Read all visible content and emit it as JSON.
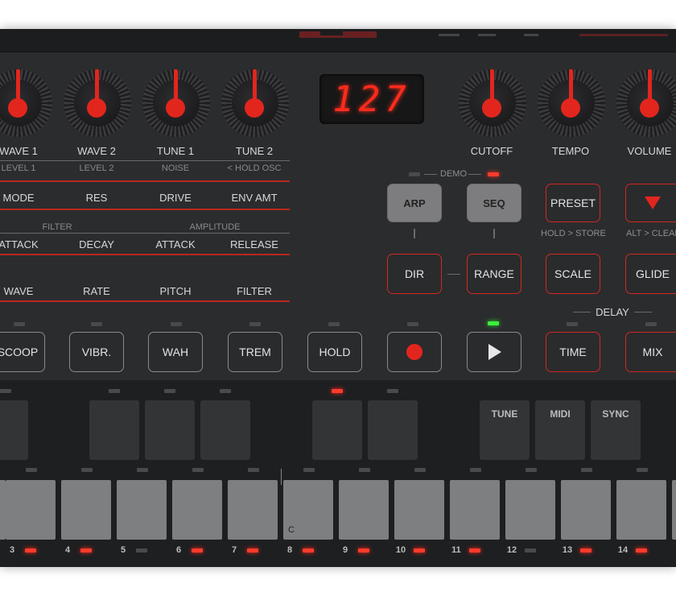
{
  "display_value": "127",
  "knobs_left": [
    {
      "label": "WAVE 1",
      "sub": "LEVEL 1"
    },
    {
      "label": "WAVE 2",
      "sub": "LEVEL 2"
    },
    {
      "label": "TUNE 1",
      "sub": "NOISE"
    },
    {
      "label": "TUNE 2",
      "sub": "< HOLD OSC"
    }
  ],
  "knobs_right": [
    {
      "label": "CUTOFF"
    },
    {
      "label": "TEMPO"
    },
    {
      "label": "VOLUME"
    }
  ],
  "param_rows": {
    "row1": [
      "MODE",
      "RES",
      "DRIVE",
      "ENV AMT"
    ],
    "section_filter": "FILTER",
    "section_amplitude": "AMPLITUDE",
    "row2": [
      "ATTACK",
      "DECAY",
      "ATTACK",
      "RELEASE"
    ],
    "row3": [
      "WAVE",
      "RATE",
      "PITCH",
      "FILTER"
    ]
  },
  "demo_label": "DEMO",
  "mode_buttons": {
    "arp": "ARP",
    "seq": "SEQ",
    "dir": "DIR",
    "range": "RANGE"
  },
  "preset_button": "PRESET",
  "hold_store": "HOLD > STORE",
  "alt_clear": "ALT > CLEAR",
  "scale_button": "SCALE",
  "glide_button": "GLIDE",
  "delay_label": "DELAY",
  "time_button": "TIME",
  "mix_button": "MIX",
  "effect_buttons": [
    "SCOOP",
    "VIBR.",
    "WAH",
    "TREM",
    "HOLD"
  ],
  "function_pads": [
    "TUNE",
    "MIDI",
    "SYNC"
  ],
  "key_c_label": "C",
  "step_numbers": [
    "3",
    "4",
    "5",
    "6",
    "7",
    "8",
    "9",
    "10",
    "11",
    "12",
    "13",
    "14"
  ],
  "colors": {
    "accent_red": "#e2261d",
    "panel": "#2b2c2e",
    "led_green": "#3cf03c"
  },
  "icons": {
    "record": "record-icon",
    "play": "play-icon",
    "down_arrow": "triangle-down-icon"
  }
}
